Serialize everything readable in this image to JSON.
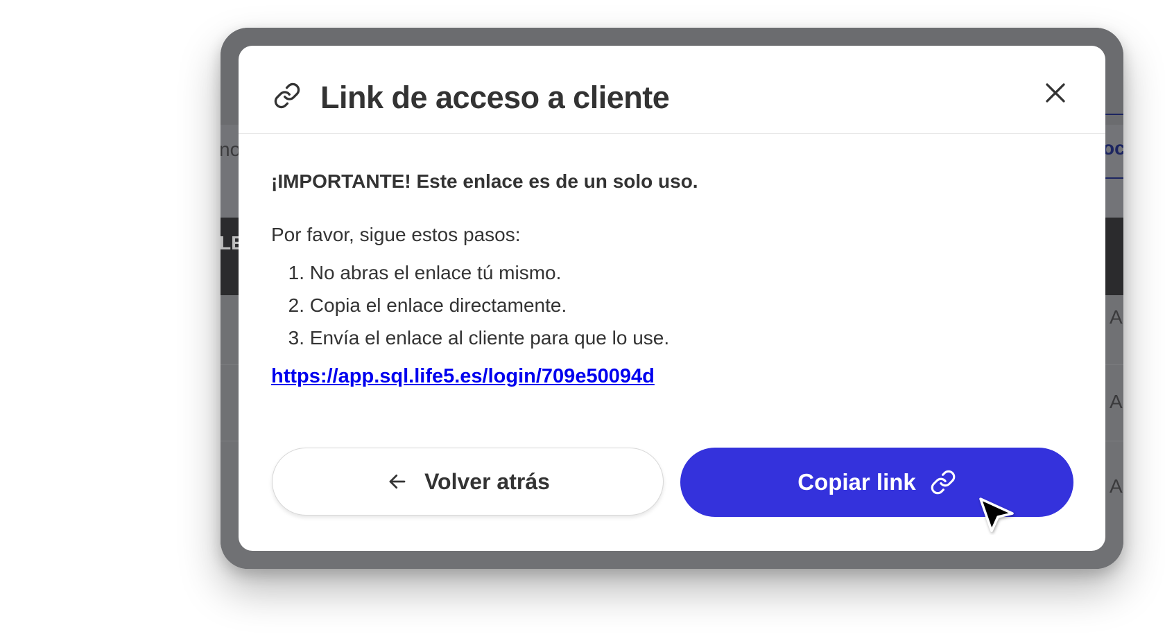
{
  "background": {
    "fragments": {
      "left_top": "no",
      "left_dark": "LE",
      "right_top": "oc",
      "right_rows": [
        "A",
        "A",
        "A"
      ]
    }
  },
  "modal": {
    "title": "Link de acceso a cliente",
    "header_icon": "link-icon",
    "close_icon": "close-icon",
    "important_text": "¡IMPORTANTE! Este enlace es de un solo uso.",
    "intro_text": "Por favor, sigue estos pasos:",
    "steps": [
      {
        "num": "1.",
        "text": "No abras el enlace tú mismo."
      },
      {
        "num": "2.",
        "text": "Copia el enlace directamente."
      },
      {
        "num": "3.",
        "text": "Envía el enlace al cliente para que lo use."
      }
    ],
    "link_text": "https://app.sql.life5.es/login/709e50094d",
    "buttons": {
      "back_label": "Volver atrás",
      "back_icon": "arrow-left-icon",
      "copy_label": "Copiar link",
      "copy_icon": "link-icon"
    }
  },
  "colors": {
    "primary": "#3432dc",
    "link": "#0000ee",
    "text": "#333333"
  }
}
